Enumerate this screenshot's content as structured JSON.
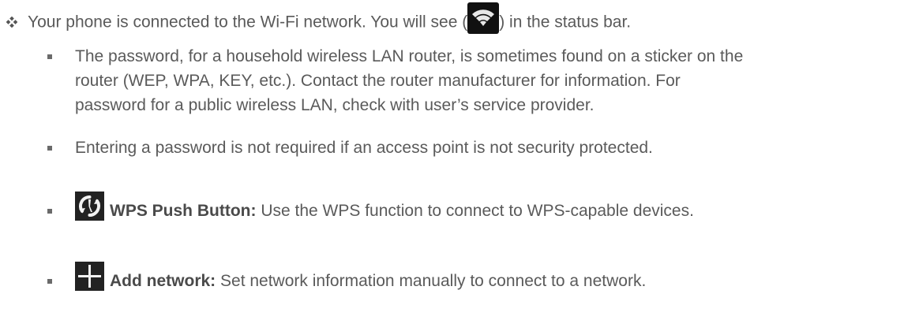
{
  "status_bullet": {
    "text_before": "Your phone is connected to the Wi-Fi network. You will see (",
    "icon": "wifi-signal-icon",
    "text_after": ") in the status bar."
  },
  "notes": [
    {
      "lines": [
        "The password, for a household wireless LAN router, is sometimes found on a sticker on the",
        "router (WEP, WPA, KEY, etc.). Contact the router manufacturer for information. For",
        "password for a public wireless LAN, check with user’s service provider."
      ]
    },
    {
      "lines": [
        "Entering a password is not required if an access point is not security protected."
      ]
    }
  ],
  "options": [
    {
      "icon": "wps-push-icon",
      "title": "WPS Push Button:",
      "description": " Use the WPS function to connect to WPS-capable devices."
    },
    {
      "icon": "add-icon",
      "title": "Add network:",
      "description": " Set network information manually to connect to a network."
    }
  ]
}
